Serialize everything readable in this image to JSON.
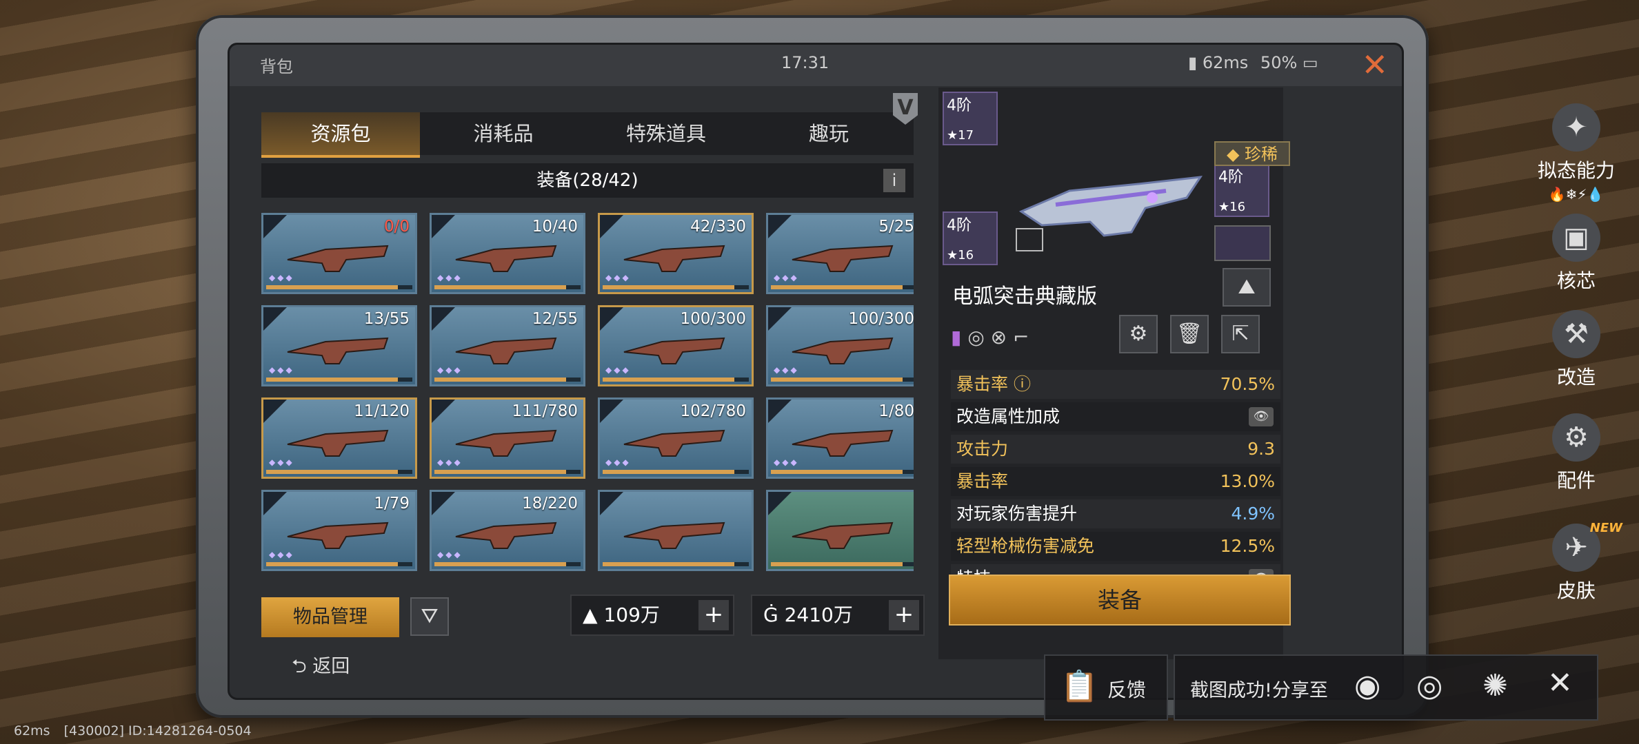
{
  "topbar": {
    "title": "背包",
    "time": "17:31",
    "ping": "62ms",
    "battery": "50%"
  },
  "tabs": [
    "资源包",
    "消耗品",
    "特殊道具",
    "趣玩"
  ],
  "subbar": {
    "label": "装备(28/42)"
  },
  "grid": [
    {
      "count": "0/0",
      "red": true,
      "fill": 0.9
    },
    {
      "count": "10/40",
      "fill": 0.9
    },
    {
      "count": "42/330",
      "fill": 0.9
    },
    {
      "count": "5/25",
      "fill": 0.9
    },
    {
      "count": "13/55",
      "fill": 0.9
    },
    {
      "count": "12/55",
      "fill": 0.9
    },
    {
      "count": "100/300",
      "fill": 0.9
    },
    {
      "count": "100/300",
      "fill": 0.9
    },
    {
      "count": "11/120",
      "fill": 0.9
    },
    {
      "count": "111/780",
      "fill": 0.9
    },
    {
      "count": "102/780",
      "fill": 0.9
    },
    {
      "count": "1/80",
      "fill": 0.9
    },
    {
      "count": "1/79",
      "fill": 0.9
    },
    {
      "count": "18/220",
      "fill": 0.9
    },
    {
      "count": "",
      "fill": 0.9
    },
    {
      "count": "",
      "fill": 0.9
    }
  ],
  "bottom": {
    "manage": "物品管理",
    "gold": "109万",
    "coin": "2410万",
    "back": "返回"
  },
  "detail": {
    "ranks": [
      {
        "lv": "4阶",
        "star": "★17"
      },
      {
        "lv": "4阶",
        "star": "★16"
      },
      {
        "lv": "4阶",
        "star": "★16"
      }
    ],
    "rarity": "珍稀",
    "name": "电弧突击典藏版",
    "stats": [
      {
        "k": "暴击率 ⓘ",
        "v": "70.5%",
        "kc": "#f2c25a",
        "vc": "#f2c25a"
      },
      {
        "k": "改造属性加成",
        "v": "",
        "kc": "#ffffff",
        "vc": "#ffffff",
        "eye": true
      },
      {
        "k": "攻击力",
        "v": "9.3",
        "kc": "#f2c25a",
        "vc": "#f2c25a"
      },
      {
        "k": "暴击率",
        "v": "13.0%",
        "kc": "#f2c25a",
        "vc": "#f2c25a"
      },
      {
        "k": "对玩家伤害提升",
        "v": "4.9%",
        "kc": "#ffffff",
        "vc": "#7fc3ff"
      },
      {
        "k": "轻型枪械伤害减免",
        "v": "12.5%",
        "kc": "#f2c25a",
        "vc": "#f2c25a"
      },
      {
        "k": "特技",
        "v": "",
        "kc": "#ffffff",
        "vc": "#ffffff",
        "eye": true
      }
    ],
    "equip": "装备"
  },
  "side": [
    {
      "label": "拟态能力",
      "icon": "mimic-icon"
    },
    {
      "label": "核芯",
      "icon": "core-icon"
    },
    {
      "label": "改造",
      "icon": "modify-icon"
    },
    {
      "label": "配件",
      "icon": "parts-icon"
    },
    {
      "label": "皮肤",
      "icon": "skin-icon",
      "badge": "NEW"
    }
  ],
  "toast": {
    "feedback": "反馈",
    "share": "截图成功!分享至"
  },
  "hud": {
    "ping": "62ms",
    "ids": "[430002] ID:14281264-0504"
  },
  "colors": {
    "accent": "#e0a540",
    "close": "#e06b3a"
  }
}
